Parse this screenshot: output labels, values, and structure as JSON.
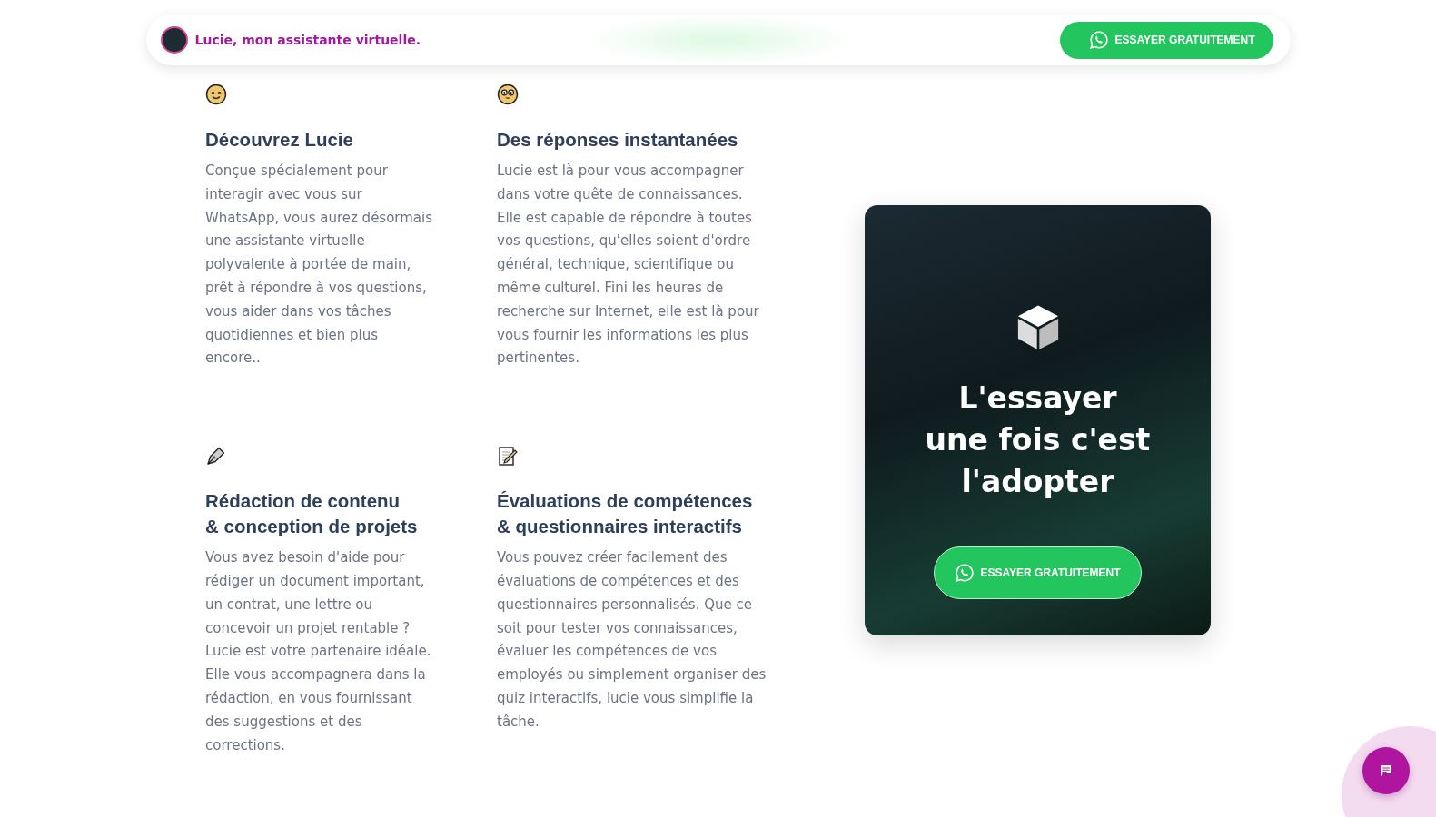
{
  "header": {
    "brand": "Lucie, mon assistante virtuelle.",
    "cta": "ESSAYER GRATUITEMENT"
  },
  "features": [
    {
      "kind": "smile",
      "title": "Découvrez Lucie",
      "text": "Conçue spécialement pour interagir avec vous sur WhatsApp, vous aurez désormais une assistante virtuelle polyvalente à portée de main, prêt à répondre à vos questions, vous aider dans vos tâches quotidiennes et bien plus encore.."
    },
    {
      "kind": "nerd",
      "title": "Des réponses instantanées",
      "text": "Lucie est là pour vous accompagner dans votre quête de connaissances. Elle est capable de répondre à toutes vos questions, qu'elles soient d'ordre général, technique, scientifique ou même culturel. Fini les heures de recherche sur Internet, elle est là pour vous fournir les informations les plus pertinentes."
    },
    {
      "kind": "pen",
      "title": "Rédaction de contenu\n& conception de projets",
      "text": "Vous avez besoin d'aide pour rédiger un document important, un contrat, une lettre ou concevoir un projet rentable ? Lucie est votre partenaire idéale. Elle vous accompagnera dans la rédaction, en vous fournissant des suggestions et des corrections."
    },
    {
      "kind": "memo",
      "title": "Évaluations de compétences\n& questionnaires interactifs",
      "text": "Vous pouvez créer facilement des évaluations de compétences et des questionnaires personnalisés. Que ce soit pour tester vos connaissances, évaluer les compétences de vos employés ou simplement organiser des quiz interactifs, lucie vous simplifie la tâche."
    }
  ],
  "promo": {
    "title": "L'essayer\nune fois c'est\nl'adopter",
    "cta": "ESSAYER GRATUITEMENT"
  }
}
